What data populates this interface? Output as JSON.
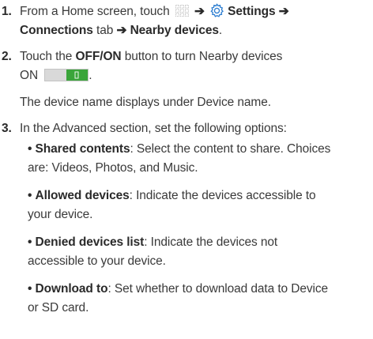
{
  "steps": [
    {
      "number": "1.",
      "line1_prefix": "From a Home screen, touch",
      "arrow": "➔",
      "settings_label": "Settings",
      "connections_label": "Connections",
      "tab_word": "tab",
      "nearby_label": "Nearby devices",
      "period": ".",
      "icons": [
        "apps-icon",
        "gear-icon"
      ]
    },
    {
      "number": "2.",
      "touch_the": "Touch the",
      "offon_label": "OFF/ON",
      "button_rest": "button to turn Nearby devices",
      "on_word": "ON",
      "period": ".",
      "note": "The device name displays under Device name.",
      "icons": [
        "toggle-on-icon"
      ],
      "toggle_color": "#3aa53a"
    },
    {
      "number": "3.",
      "intro": "In the Advanced section, set the following options:",
      "bullets": [
        {
          "term": "Shared contents",
          "desc_line1": ": Select the content to share. Choices",
          "desc_line2": "are: Videos, Photos, and Music."
        },
        {
          "term": "Allowed devices",
          "desc_line1": ": Indicate the devices accessible to",
          "desc_line2": "your device."
        },
        {
          "term": "Denied devices list",
          "desc_line1": ": Indicate the devices not",
          "desc_line2": "accessible to your device."
        },
        {
          "term": "Download to",
          "desc_line1": ": Set whether to download data to Device",
          "desc_line2": "or SD card."
        }
      ]
    }
  ],
  "bullet_char": "•",
  "colors": {
    "text": "#3a3a3a",
    "bold": "#2a2a2a",
    "gear": "#2f7fd1",
    "toggle_green": "#3aa53a"
  }
}
